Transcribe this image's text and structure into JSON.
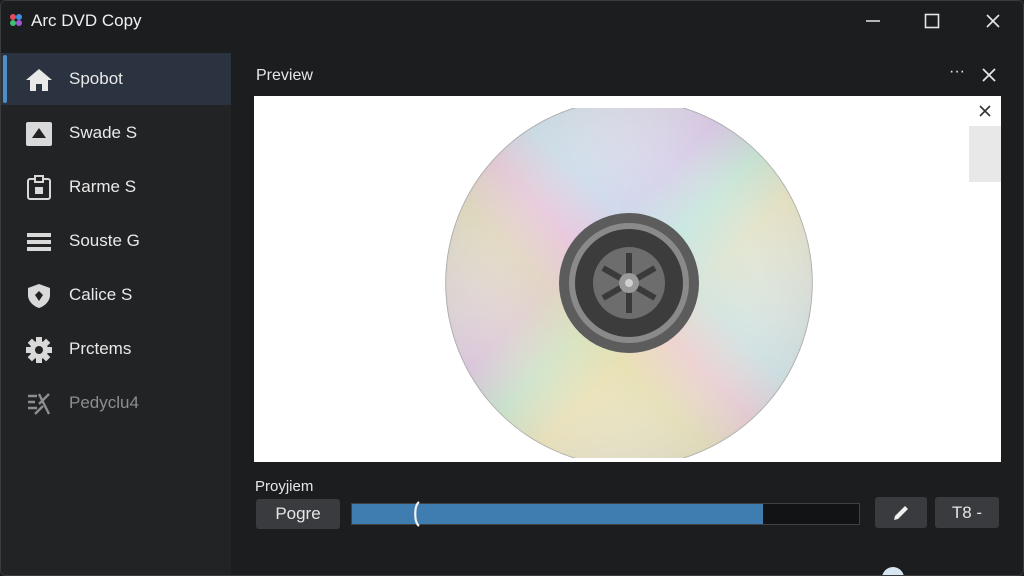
{
  "window": {
    "title": "Arc DVD Copy",
    "accent": "#4f8fc9",
    "icons": [
      "minimize-icon",
      "maximize-icon",
      "close-icon"
    ]
  },
  "sidebar": {
    "items": [
      {
        "label": "Spobot",
        "icon": "home-icon",
        "active": true
      },
      {
        "label": "Swade S",
        "icon": "eject-icon",
        "active": false
      },
      {
        "label": "Rarme S",
        "icon": "drive-icon",
        "active": false
      },
      {
        "label": "Souste G",
        "icon": "list-icon",
        "active": false
      },
      {
        "label": "Calice S",
        "icon": "shield-icon",
        "active": false
      },
      {
        "label": "Prctems",
        "icon": "gear-icon",
        "active": false
      },
      {
        "label": "Pedyclu4",
        "icon": "tools-icon",
        "active": false,
        "dimmed": true
      }
    ]
  },
  "preview": {
    "title": "Preview",
    "more_label": "···",
    "image": "dvd-disc"
  },
  "progress": {
    "label": "Proyjiem",
    "pause_label": "Pogre",
    "value_fraction": 0.81,
    "fill_color": "#3f7cb0",
    "speed_label": "T8 -"
  }
}
